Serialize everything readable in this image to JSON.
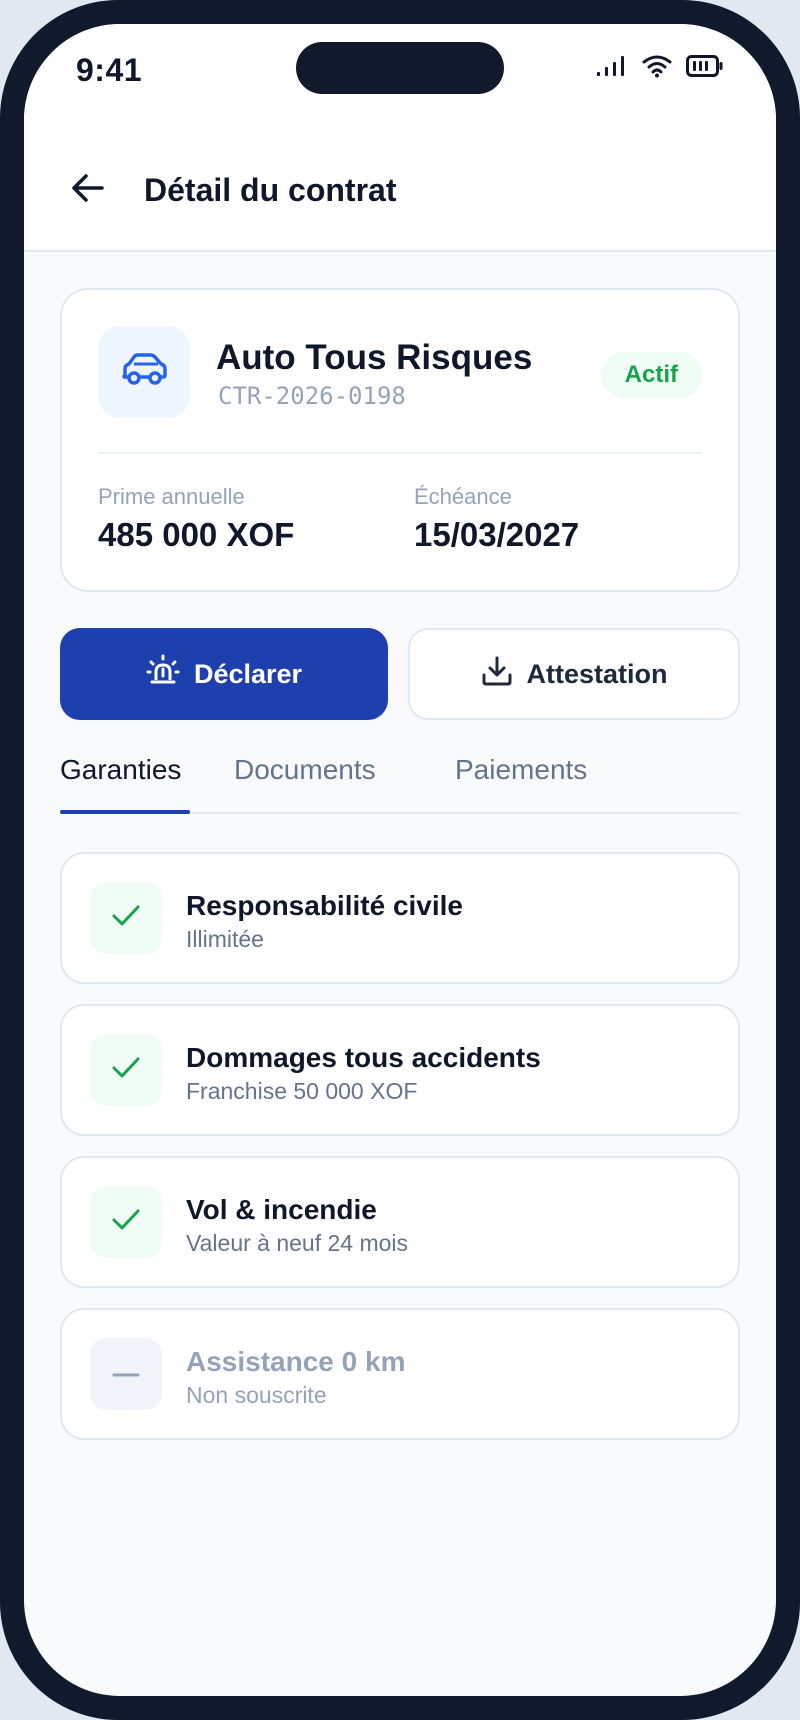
{
  "status_bar": {
    "time": "9:41"
  },
  "header": {
    "title": "Détail du contrat"
  },
  "contract": {
    "name": "Auto Tous Risques",
    "reference": "CTR-2026-0198",
    "status": "Actif",
    "premium_label": "Prime annuelle",
    "premium_value": "485 000 XOF",
    "due_label": "Échéance",
    "due_value": "15/03/2027"
  },
  "actions": {
    "declare_label": "Déclarer",
    "attestation_label": "Attestation"
  },
  "tabs": [
    {
      "label": "Garanties",
      "active": true
    },
    {
      "label": "Documents",
      "active": false
    },
    {
      "label": "Paiements",
      "active": false
    }
  ],
  "guarantees": [
    {
      "title": "Responsabilité civile",
      "subtitle": "Illimitée",
      "included": true
    },
    {
      "title": "Dommages tous accidents",
      "subtitle": "Franchise 50 000 XOF",
      "included": true
    },
    {
      "title": "Vol & incendie",
      "subtitle": "Valeur à neuf 24 mois",
      "included": true
    },
    {
      "title": "Assistance 0 km",
      "subtitle": "Non souscrite",
      "included": false
    }
  ],
  "icons": {
    "back": "arrow-left-icon",
    "car": "car-icon",
    "siren": "siren-icon",
    "download": "download-icon",
    "check": "check-icon",
    "dash": "dash-icon"
  },
  "colors": {
    "primary": "#1e40af",
    "success": "#16a34a",
    "success_bg": "#f0fdf4",
    "text": "#0f172a",
    "muted": "#64748b",
    "faint": "#94a3b8",
    "frame": "#111a2c"
  }
}
